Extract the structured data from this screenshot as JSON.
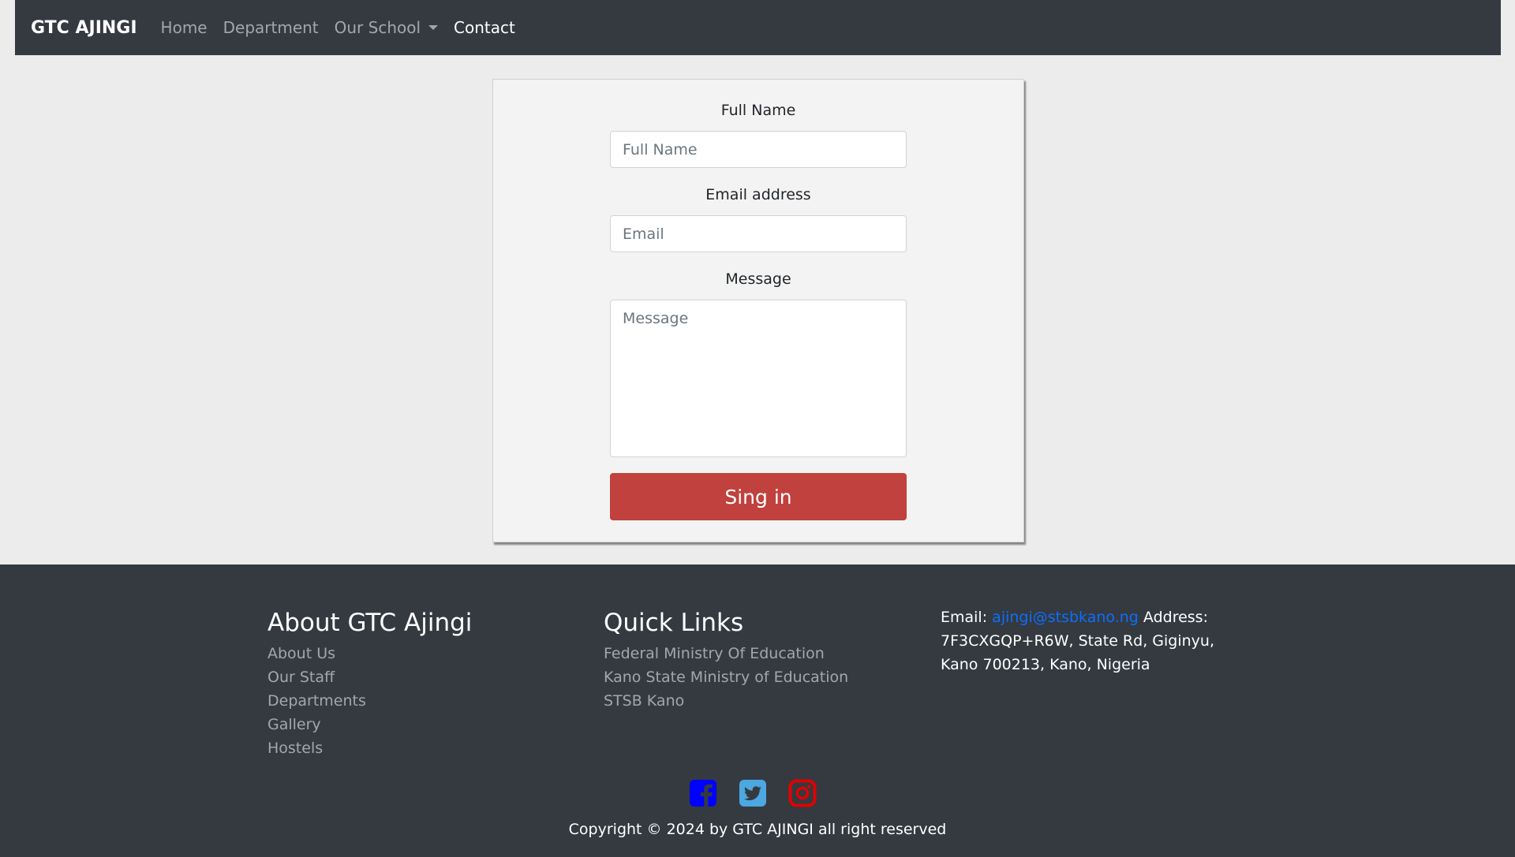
{
  "navbar": {
    "brand": "GTC AJINGI",
    "links": [
      {
        "label": "Home"
      },
      {
        "label": "Department"
      },
      {
        "label": "Our School"
      },
      {
        "label": "Contact"
      }
    ]
  },
  "form": {
    "full_name_label": "Full Name",
    "full_name_placeholder": "Full Name",
    "email_label": "Email address",
    "email_placeholder": "Email",
    "message_label": "Message",
    "message_placeholder": "Message",
    "submit_label": "Sing in",
    "submit_color": "#c0413d"
  },
  "footer": {
    "about": {
      "title": "About GTC Ajingi",
      "links": [
        "About Us",
        "Our Staff",
        "Departments",
        "Gallery",
        "Hostels"
      ]
    },
    "quick_links": {
      "title": "Quick Links",
      "links": [
        "Federal Ministry Of Education",
        "Kano State Ministry of Education",
        "STSB Kano"
      ]
    },
    "contact": {
      "email_prefix": "Email:",
      "email": "ajingi@stsbkano.ng",
      "address_prefix": "Address:",
      "address": "7F3CXGQP+R6W, State Rd, Giginyu, Kano 700213, Kano, Nigeria"
    },
    "socials": [
      {
        "name": "facebook-icon",
        "color": "#0000ff"
      },
      {
        "name": "twitter-icon",
        "color": "#4da7e0"
      },
      {
        "name": "instagram-icon",
        "color": "#e00000"
      }
    ],
    "copyright": "Copyright © 2024 by GTC AJINGI all right reserved"
  }
}
